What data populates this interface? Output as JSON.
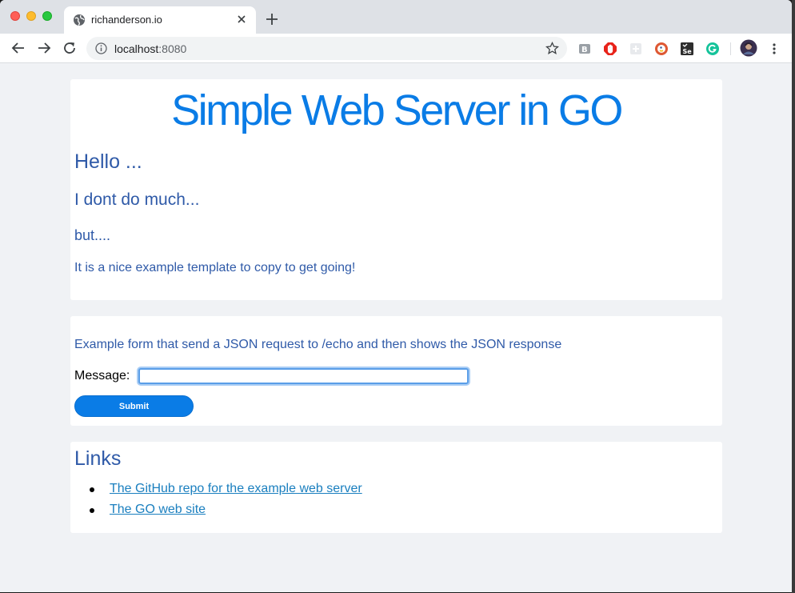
{
  "browser": {
    "tab_title": "richanderson.io",
    "url_host": "localhost",
    "url_port": ":8080"
  },
  "page": {
    "title": "Simple Web Server in GO",
    "hello": "Hello ...",
    "dont": "I dont do much...",
    "but": "but....",
    "nice": "It is a nice example template to copy to get going!"
  },
  "form": {
    "description": "Example form that send a JSON request to /echo and then shows the JSON response",
    "message_label": "Message:",
    "message_value": "",
    "submit_label": "Submit"
  },
  "links": {
    "title": "Links",
    "items": [
      {
        "label": "The GitHub repo for the example web server"
      },
      {
        "label": "The GO web site"
      }
    ]
  },
  "colors": {
    "accent": "#0a7ce6",
    "heading": "#2f5aa8",
    "link": "#1a7fbf",
    "page_bg": "#f0f2f5"
  },
  "icons": [
    "globe-icon",
    "close-icon",
    "plus-icon",
    "back-icon",
    "forward-icon",
    "reload-icon",
    "info-icon",
    "star-icon",
    "readmode-icon",
    "adblock-icon",
    "extension-icon",
    "duckduckgo-icon",
    "selenium-icon",
    "grammarly-icon",
    "avatar",
    "menu-icon"
  ]
}
